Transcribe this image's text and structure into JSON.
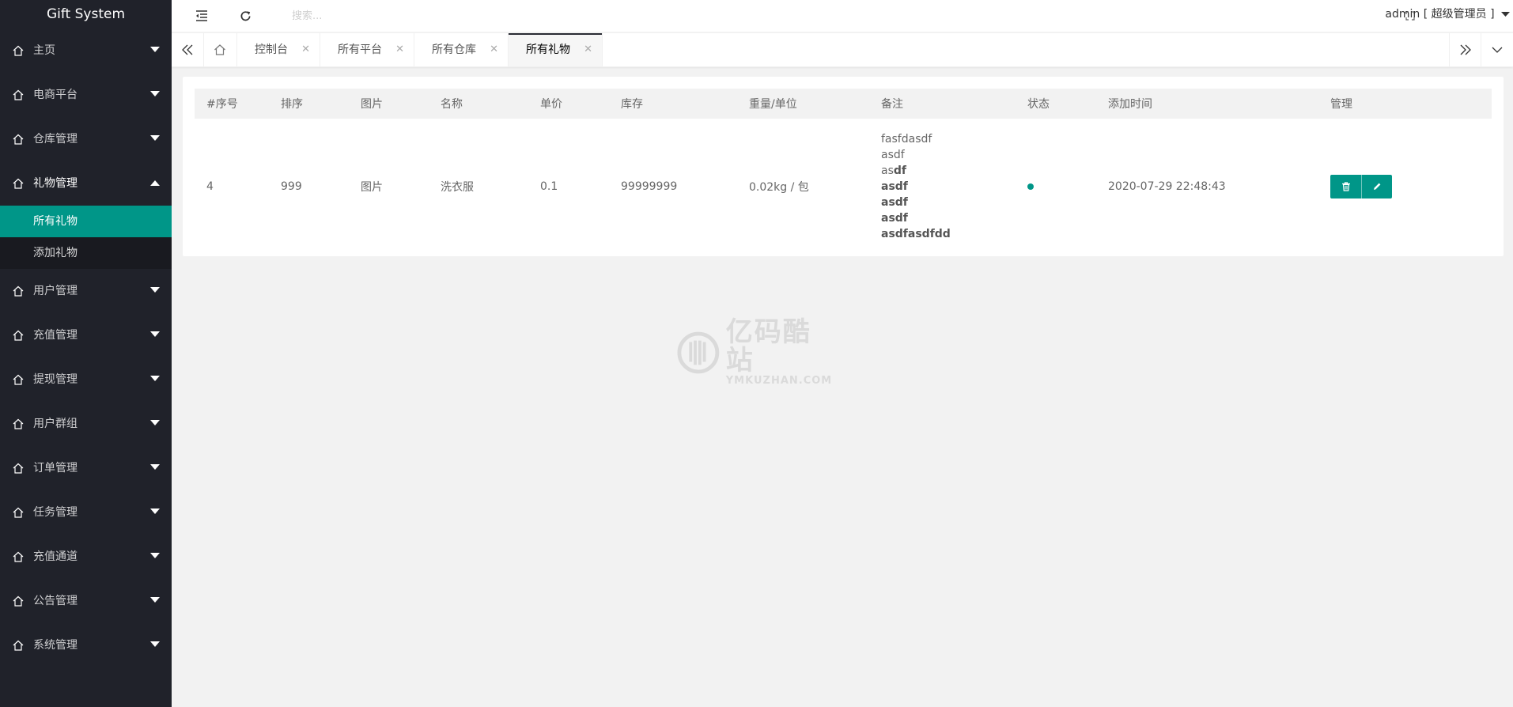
{
  "app": {
    "title": "Gift System"
  },
  "sidebar": {
    "items": [
      {
        "label": "主页"
      },
      {
        "label": "电商平台"
      },
      {
        "label": "仓库管理"
      },
      {
        "label": "礼物管理"
      },
      {
        "label": "用户管理"
      },
      {
        "label": "充值管理"
      },
      {
        "label": "提现管理"
      },
      {
        "label": "用户群组"
      },
      {
        "label": "订单管理"
      },
      {
        "label": "任务管理"
      },
      {
        "label": "充值通道"
      },
      {
        "label": "公告管理"
      },
      {
        "label": "系统管理"
      }
    ],
    "gift_submenu": [
      {
        "label": "所有礼物",
        "active": true
      },
      {
        "label": "添加礼物",
        "active": false
      }
    ]
  },
  "header": {
    "search_placeholder": "搜索...",
    "user_label": "admin [ 超级管理员 ]"
  },
  "tabs": [
    {
      "label": "控制台"
    },
    {
      "label": "所有平台"
    },
    {
      "label": "所有仓库"
    },
    {
      "label": "所有礼物",
      "active": true
    }
  ],
  "table": {
    "columns": [
      "#序号",
      "排序",
      "图片",
      "名称",
      "单价",
      "库存",
      "重量/单位",
      "备注",
      "状态",
      "添加时间",
      "管理"
    ],
    "rows": [
      {
        "id": "4",
        "sort": "999",
        "image": "图片",
        "name": "洗衣服",
        "price": "0.1",
        "stock": "99999999",
        "weight": "0.02kg / 包",
        "remark": {
          "line1": "fasfdasdf",
          "line2": "asdf",
          "line3_plain": "as",
          "line3_bold": "df",
          "line4": "asdf",
          "line5": "asdf",
          "line6": "asdf",
          "line7": "asdfasdfdd"
        },
        "status_color": "#009688",
        "added": "2020-07-29 22:48:43"
      }
    ]
  },
  "watermark": {
    "big": "亿码酷站",
    "small": "YMKUZHAN.COM"
  },
  "colors": {
    "accent": "#009688",
    "sidebar_bg": "#20222a",
    "submenu_bg": "#191a20"
  },
  "icons": {
    "menu_item": "home-icon",
    "expand": "chevron-down-icon",
    "collapse": "chevron-up-icon",
    "delete": "trash-icon",
    "edit": "pencil-icon"
  }
}
